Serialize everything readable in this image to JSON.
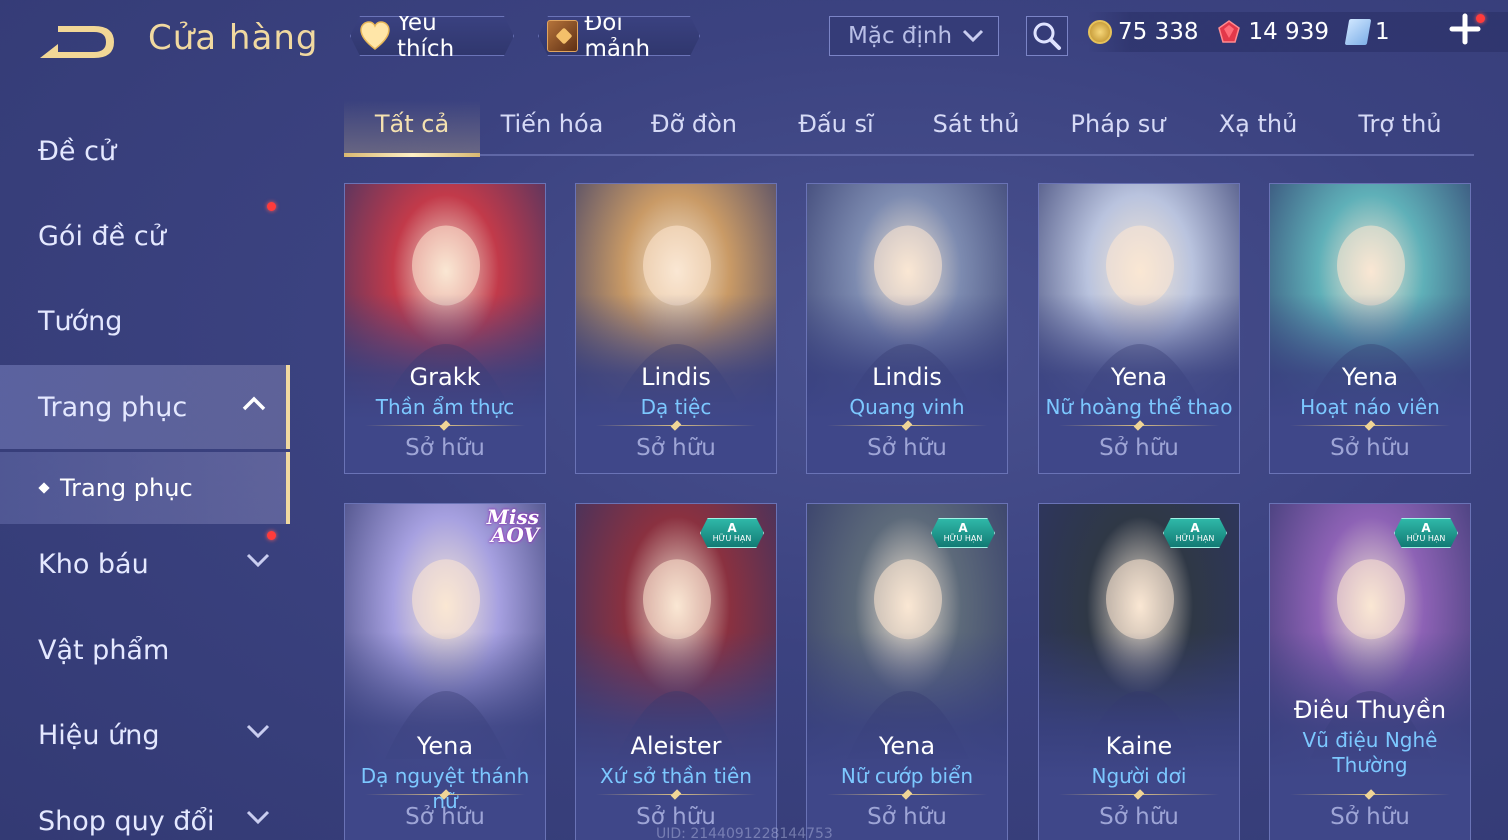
{
  "header": {
    "title": "Cửa hàng",
    "favorites_label": "Yêu thích",
    "exchange_label": "Đổi mảnh",
    "sort_value": "Mặc định",
    "currencies": [
      {
        "icon": "gold-coin-icon",
        "value": "75 338"
      },
      {
        "icon": "ruby-gem-icon",
        "value": "14 939"
      },
      {
        "icon": "voucher-icon",
        "value": "1"
      }
    ]
  },
  "sidebar": {
    "items": [
      {
        "label": "Đề cử"
      },
      {
        "label": "Gói đề cử"
      },
      {
        "label": "Tướng"
      },
      {
        "label": "Trang phục"
      },
      {
        "label": "Kho báu"
      },
      {
        "label": "Vật phẩm"
      },
      {
        "label": "Hiệu ứng"
      },
      {
        "label": "Shop quy đổi"
      }
    ],
    "sub_item": "Trang phục"
  },
  "tabs": [
    "Tất cả",
    "Tiến hóa",
    "Đỡ đòn",
    "Đấu sĩ",
    "Sát thủ",
    "Pháp sư",
    "Xạ thủ",
    "Trợ thủ"
  ],
  "cards": [
    {
      "hero": "Grakk",
      "skin": "Thần ẩm thực",
      "status": "Sở hữu",
      "accent": "#c23a4a"
    },
    {
      "hero": "Lindis",
      "skin": "Dạ tiệc",
      "status": "Sở hữu",
      "accent": "#c99a66"
    },
    {
      "hero": "Lindis",
      "skin": "Quang vinh",
      "status": "Sở hữu",
      "accent": "#7d8bb0"
    },
    {
      "hero": "Yena",
      "skin": "Nữ hoàng thể thao",
      "status": "Sở hữu",
      "accent": "#b9c3de"
    },
    {
      "hero": "Yena",
      "skin": "Hoạt náo viên",
      "status": "Sở hữu",
      "accent": "#5fb0b8"
    },
    {
      "hero": "Yena",
      "skin": "Dạ nguyệt thánh nữ",
      "status": "Sở hữu",
      "accent": "#a6a0e0",
      "logo": [
        "Miss",
        "AOV"
      ]
    },
    {
      "hero": "Aleister",
      "skin": "Xứ sở thần tiên",
      "status": "Sở hữu",
      "accent": "#8a3140",
      "badge": [
        "A",
        "HỮU HẠN"
      ]
    },
    {
      "hero": "Yena",
      "skin": "Nữ cướp biển",
      "status": "Sở hữu",
      "accent": "#5d6a7a",
      "badge": [
        "A",
        "HỮU HẠN"
      ]
    },
    {
      "hero": "Kaine",
      "skin": "Người dơi",
      "status": "Sở hữu",
      "accent": "#2f3846",
      "badge": [
        "A",
        "HỮU HẠN"
      ]
    },
    {
      "hero": "Điêu Thuyền",
      "skin": "Vũ điệu Nghê Thường",
      "status": "Sở hữu",
      "accent": "#8d62b5",
      "badge": [
        "A",
        "HỮU HẠN"
      ]
    }
  ],
  "uid": "UID: 2144091228144753"
}
